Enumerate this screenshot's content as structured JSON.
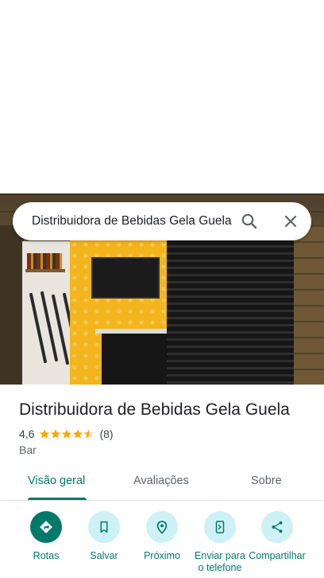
{
  "search": {
    "query": "Distribuidora de Bebidas Gela Guela"
  },
  "place": {
    "name": "Distribuidora de Bebidas Gela Guela",
    "rating": "4,6",
    "stars": 4.6,
    "reviews": "(8)",
    "category": "Bar"
  },
  "tabs": [
    {
      "label": "Visão geral",
      "active": true
    },
    {
      "label": "Avaliações",
      "active": false
    },
    {
      "label": "Sobre",
      "active": false
    }
  ],
  "actions": [
    {
      "label": "Rotas",
      "icon": "directions-icon"
    },
    {
      "label": "Salvar",
      "icon": "bookmark-icon"
    },
    {
      "label": "Próximo",
      "icon": "nearby-icon"
    },
    {
      "label": "Enviar para o telefone",
      "icon": "send-to-phone-icon"
    },
    {
      "label": "Compartilhar",
      "icon": "share-icon"
    }
  ],
  "colors": {
    "accent": "#00796b",
    "action_bg": "#cdf1f5",
    "star": "#f9ab00"
  }
}
